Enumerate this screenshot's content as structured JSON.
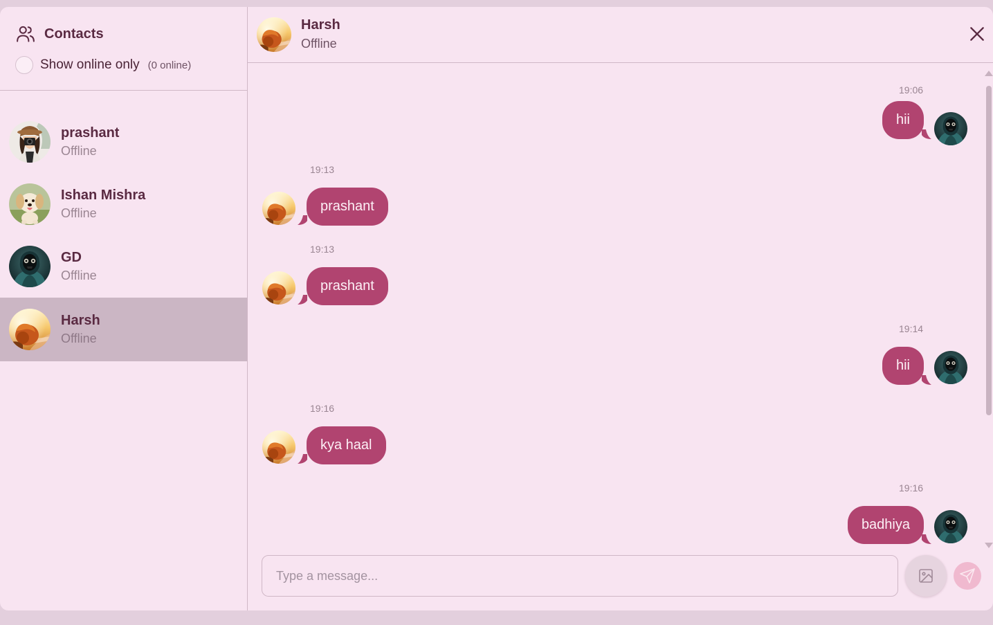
{
  "sidebar": {
    "title": "Contacts",
    "filter_label": "Show online only",
    "online_count": "(0 online)",
    "contacts": [
      {
        "name": "prashant",
        "status": "Offline",
        "avatar": "camera-girl-avatar"
      },
      {
        "name": "Ishan Mishra",
        "status": "Offline",
        "avatar": "puppy-avatar"
      },
      {
        "name": "GD",
        "status": "Offline",
        "avatar": "masked-figure-avatar"
      },
      {
        "name": "Harsh",
        "status": "Offline",
        "avatar": "sunset-dog-avatar",
        "selected": true
      }
    ]
  },
  "chat": {
    "name": "Harsh",
    "status": "Offline",
    "messages": [
      {
        "time": "19:06",
        "text": "hii",
        "side": "right"
      },
      {
        "time": "19:13",
        "text": "prashant",
        "side": "left"
      },
      {
        "time": "19:13",
        "text": "prashant",
        "side": "left"
      },
      {
        "time": "19:14",
        "text": "hii",
        "side": "right"
      },
      {
        "time": "19:16",
        "text": "kya haal",
        "side": "left"
      },
      {
        "time": "19:16",
        "text": "badhiya",
        "side": "right"
      }
    ],
    "input_placeholder": "Type a message..."
  },
  "icons": {
    "contacts": "users-icon",
    "close": "close-icon",
    "image": "image-icon",
    "send": "send-icon"
  },
  "colors": {
    "background": "#f8e4f1",
    "bubble": "#b14470",
    "selected_contact": "#cbb6c4",
    "send_button": "#f0b9cf"
  }
}
